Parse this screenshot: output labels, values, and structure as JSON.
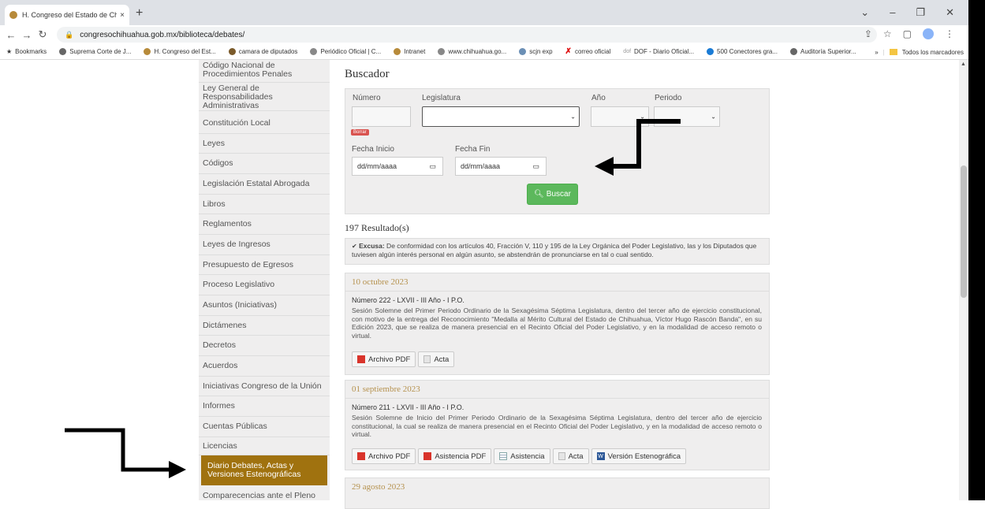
{
  "browser": {
    "tab_title": "H. Congreso del Estado de Chih...",
    "tab_close": "×",
    "new_tab": "+",
    "url": "congresochihuahua.gob.mx/biblioteca/debates/",
    "window_controls": [
      "⌄",
      "–",
      "❐",
      "✕"
    ]
  },
  "bookmarks": {
    "items": [
      "Bookmarks",
      "Suprema Corte de J...",
      "H. Congreso del Est...",
      "camara de diputados",
      "Periódico Oficial | C...",
      "Intranet",
      "www.chihuahua.go...",
      "scjn exp",
      "correo oficial",
      "DOF - Diario Oficial...",
      "500 Conectores gra...",
      "Auditoría Superior..."
    ],
    "more": "»",
    "all_bookmarks": "Todos los marcadores"
  },
  "sidebar": {
    "items": [
      "Código Nacional de Procedimientos Penales",
      "Ley General de Responsabilidades Administrativas",
      "Constitución Local",
      "Leyes",
      "Códigos",
      "Legislación Estatal Abrogada",
      "Libros",
      "Reglamentos",
      "Leyes de Ingresos",
      "Presupuesto de Egresos",
      "Proceso Legislativo",
      "Asuntos (Iniciativas)",
      "Dictámenes",
      "Decretos",
      "Acuerdos",
      "Iniciativas Congreso de la Unión",
      "Informes",
      "Cuentas Públicas",
      "Licencias",
      "Diario Debates, Actas y Versiones Estenográficas",
      "Comparecencias ante el Pleno"
    ],
    "active_index": 19
  },
  "search": {
    "title": "Buscador",
    "numero_label": "Número",
    "legislatura_label": "Legislatura",
    "anio_label": "Año",
    "periodo_label": "Periodo",
    "borrar": "Borrar",
    "fecha_inicio_label": "Fecha Inicio",
    "fecha_fin_label": "Fecha Fin",
    "date_placeholder": "dd/mm/aaaa",
    "buscar": "Buscar"
  },
  "results": {
    "count": "197 Resultado(s)",
    "excusa_label": "Excusa:",
    "excusa_text": " De conformidad con los artículos 40, Fracción V, 110 y 195 de la Ley Orgánica del Poder Legislativo, las y los Diputados que tuviesen algún interés personal en algún asunto, se abstendrán de pronunciarse en tal o cual sentido.",
    "cards": [
      {
        "date": "10 octubre 2023",
        "number": "Número 222 - LXVII - III Año - I P.O.",
        "description": "Sesión Solemne del Primer Periodo Ordinario de la Sexagésima Séptima Legislatura, dentro del tercer año de ejercicio constitucional, con motivo de la entrega del Reconocimiento \"Medalla al Mérito Cultural del Estado de Chihuahua, Víctor Hugo Rascón Banda\", en su Edición 2023, que se realiza de manera presencial en el Recinto Oficial del Poder Legislativo, y en la modalidad de acceso remoto o virtual.",
        "buttons": [
          "Archivo PDF",
          "Acta"
        ]
      },
      {
        "date": "01 septiembre 2023",
        "number": "Número 211 - LXVII - III Año - I P.O.",
        "description": "Sesión Solemne de Inicio del Primer Periodo Ordinario de la Sexagésima Séptima Legislatura, dentro del tercer año de ejercicio constitucional, la cual se realiza de manera presencial en el Recinto Oficial del Poder Legislativo, y en la modalidad de acceso remoto o virtual.",
        "buttons": [
          "Archivo PDF",
          "Asistencia PDF",
          "Asistencia",
          "Acta",
          "Versión Estenográfica"
        ]
      },
      {
        "date": "29 agosto 2023"
      }
    ]
  },
  "colors": {
    "accent_gold": "#a0720f",
    "date_gold": "#b5914d",
    "buscar_green": "#5cb85c",
    "pdf_red": "#d9342b"
  }
}
